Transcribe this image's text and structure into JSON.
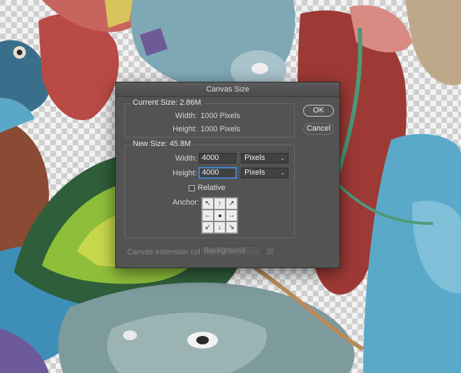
{
  "dialog": {
    "title": "Canvas Size",
    "current_size": {
      "heading": "Current Size: 2.86M",
      "width_label": "Width:",
      "width_value": "1000 Pixels",
      "height_label": "Height:",
      "height_value": "1000 Pixels"
    },
    "new_size": {
      "heading": "New Size: 45.8M",
      "width_label": "Width:",
      "width_value": "4000",
      "width_unit": "Pixels",
      "height_label": "Height:",
      "height_value": "4000",
      "height_unit": "Pixels",
      "relative_label": "Relative",
      "relative_checked": false,
      "anchor_label": "Anchor:",
      "anchor_arrows": [
        "↖",
        "↑",
        "↗",
        "←",
        "",
        "→",
        "↙",
        "↓",
        "↘"
      ]
    },
    "ok_label": "OK",
    "cancel_label": "Cancel",
    "extension_color_label": "Canvas extension color:",
    "extension_color_value": "Background"
  },
  "colors": {
    "dialog_bg": "#535353",
    "focus_ring": "#4d8ed9"
  }
}
